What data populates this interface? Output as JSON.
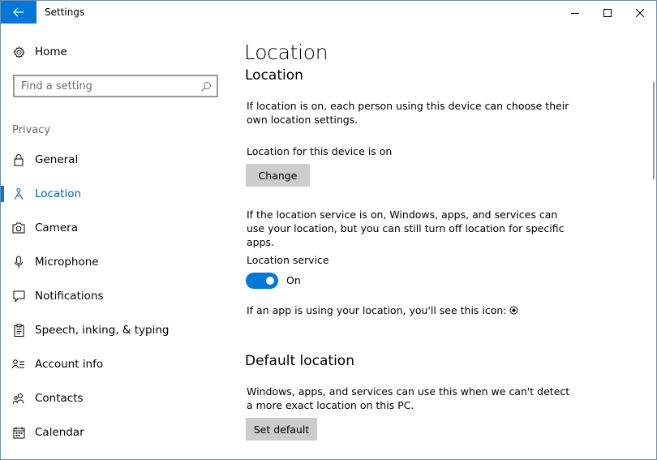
{
  "window": {
    "title": "Settings"
  },
  "sidebar": {
    "home_label": "Home",
    "search_placeholder": "Find a setting",
    "section_label": "Privacy",
    "items": [
      {
        "label": "General"
      },
      {
        "label": "Location"
      },
      {
        "label": "Camera"
      },
      {
        "label": "Microphone"
      },
      {
        "label": "Notifications"
      },
      {
        "label": "Speech, inking, & typing"
      },
      {
        "label": "Account info"
      },
      {
        "label": "Contacts"
      },
      {
        "label": "Calendar"
      }
    ],
    "active_item": "Location"
  },
  "main": {
    "page_title": "Location",
    "section1_title": "Location",
    "intro_text": "If location is on, each person using this device can choose their own location settings.",
    "device_status": "Location for this device is on",
    "change_button": "Change",
    "service_text": "If the location service is on, Windows, apps, and services can use your location, but you can still turn off location for specific apps.",
    "service_label": "Location service",
    "service_toggle_state": "On",
    "icon_hint": "If an app is using your location, you'll see this icon:",
    "section2_title": "Default location",
    "default_text": "Windows, apps, and services can use this when we can't detect a more exact location on this PC.",
    "set_default_button": "Set default"
  },
  "colors": {
    "accent": "#0078d7",
    "active_text": "#0063b1",
    "button_bg": "#cccccc",
    "secondary_text": "#6d6d6d"
  }
}
